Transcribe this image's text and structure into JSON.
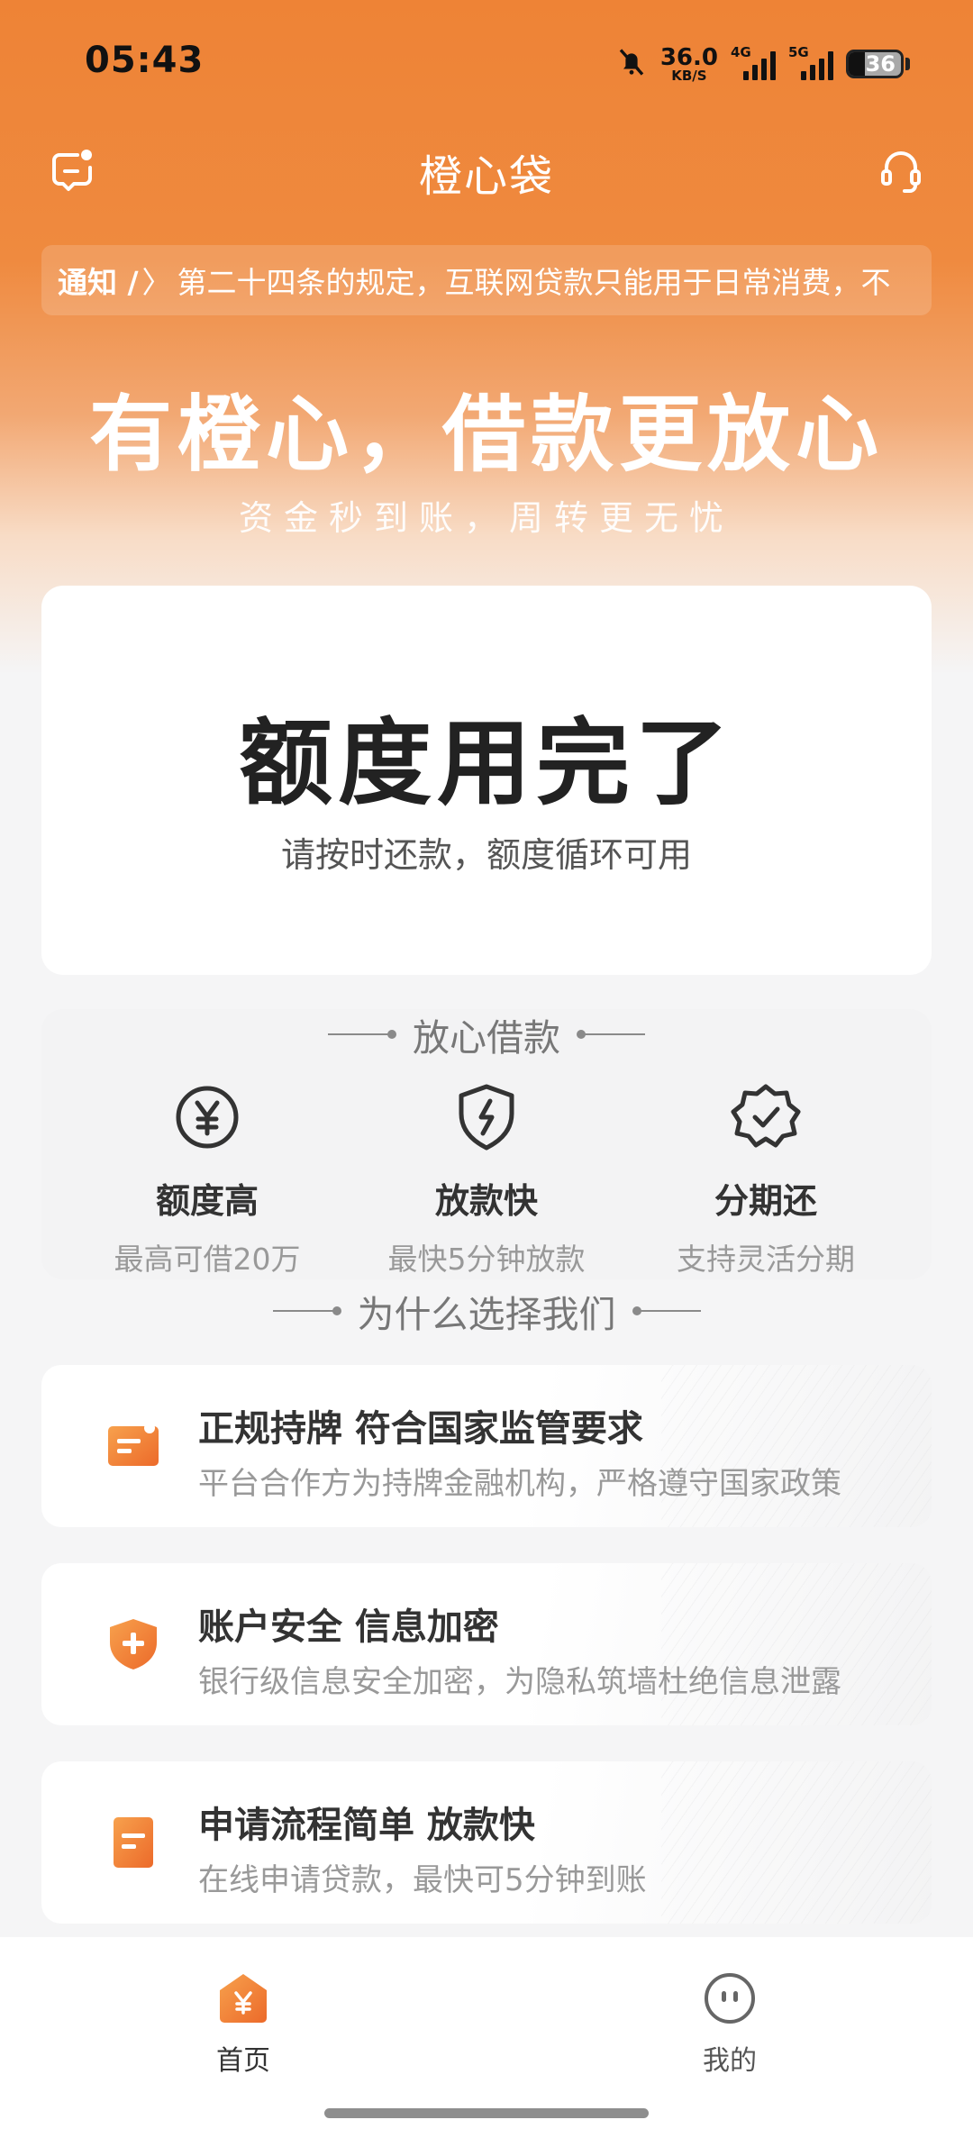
{
  "status_bar": {
    "time": "05:43",
    "net_speed_value": "36.0",
    "net_speed_unit": "KB/S",
    "signal1_label": "4G",
    "signal2_label": "5G",
    "battery": "36"
  },
  "header": {
    "title": "橙心袋",
    "left_icon": "message-icon",
    "right_icon": "headset-icon"
  },
  "notice": {
    "label": "通知 /",
    "separator": "〉",
    "text": "第二十四条的规定，互联网贷款只能用于日常消费，不"
  },
  "hero": {
    "slogan": "有橙心，借款更放心",
    "sub_slogan": "资金秒到账，周转更无忧"
  },
  "quota": {
    "title": "额度用完了",
    "subtitle": "请按时还款，额度循环可用"
  },
  "features_section": {
    "title": "放心借款",
    "items": [
      {
        "icon": "yen-circle-icon",
        "name": "额度高",
        "desc": "最高可借20万"
      },
      {
        "icon": "lightning-shield-icon",
        "name": "放款快",
        "desc": "最快5分钟放款"
      },
      {
        "icon": "check-badge-icon",
        "name": "分期还",
        "desc": "支持灵活分期"
      }
    ]
  },
  "why_section": {
    "title": "为什么选择我们",
    "items": [
      {
        "icon": "license-icon",
        "title": "正规持牌 符合国家监管要求",
        "desc": "平台合作方为持牌金融机构，严格遵守国家政策"
      },
      {
        "icon": "security-shield-icon",
        "title": "账户安全 信息加密",
        "desc": "银行级信息安全加密，为隐私筑墙杜绝信息泄露"
      },
      {
        "icon": "document-icon",
        "title": "申请流程简单 放款快",
        "desc": "在线申请贷款，最快可5分钟到账"
      }
    ]
  },
  "tabbar": {
    "items": [
      {
        "label": "首页",
        "icon": "home-yen-icon",
        "active": true
      },
      {
        "label": "我的",
        "icon": "profile-face-icon",
        "active": false
      }
    ]
  },
  "colors": {
    "brand": "#ee8336",
    "icon_gradient_start": "#f7a14d",
    "icon_gradient_end": "#ec6a2a",
    "text_dark": "#222222",
    "text_muted": "#999999"
  }
}
